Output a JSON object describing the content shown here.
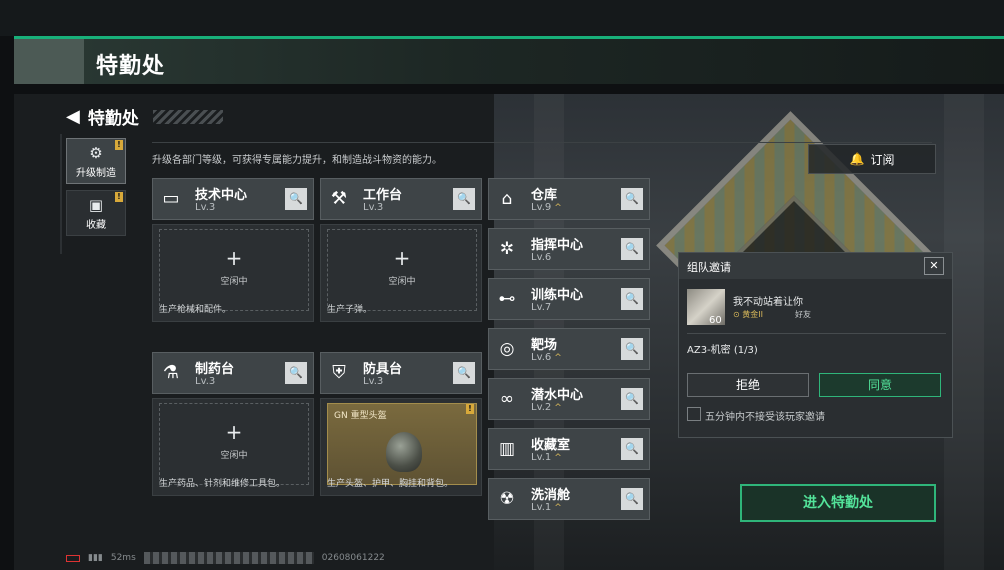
{
  "header": {
    "title": "特勤处"
  },
  "nav": {
    "back_label": "特勤处",
    "back_icon": "back-arrow-icon"
  },
  "description": "升级各部门等级，可获得专属能力提升，和制造战斗物资的能力。",
  "left_tabs": [
    {
      "label": "升级制造",
      "icon": "gear-upgrade-icon",
      "active": true,
      "alert": "!"
    },
    {
      "label": "收藏",
      "icon": "safe-icon",
      "active": false,
      "alert": "!"
    }
  ],
  "cards": [
    {
      "name": "技术中心",
      "level": "Lv.3",
      "icon": "monitor-icon",
      "slot": {
        "plus": "+",
        "status": "空闲中"
      },
      "footer": "生产枪械和配件。"
    },
    {
      "name": "工作台",
      "level": "Lv.3",
      "icon": "tools-icon",
      "slot": {
        "plus": "+",
        "status": "空闲中"
      },
      "footer": "生产子弹。"
    },
    {
      "name": "制药台",
      "level": "Lv.3",
      "icon": "microscope-icon",
      "slot": {
        "plus": "+",
        "status": "空闲中"
      },
      "footer": "生产药品、针剂和维修工具包。"
    },
    {
      "name": "防具台",
      "level": "Lv.3",
      "icon": "armor-icon",
      "slot": {
        "item_name": "GN 重型头盔",
        "alert": "!"
      },
      "footer": "生产头盔、护甲、胸挂和背包。"
    }
  ],
  "departments": [
    {
      "name": "仓库",
      "level": "Lv.9",
      "icon": "warehouse-icon",
      "upgrade": "^"
    },
    {
      "name": "指挥中心",
      "level": "Lv.6",
      "icon": "command-chip-icon",
      "upgrade": ""
    },
    {
      "name": "训练中心",
      "level": "Lv.7",
      "icon": "dumbbell-icon",
      "upgrade": ""
    },
    {
      "name": "靶场",
      "level": "Lv.6",
      "icon": "target-icon",
      "upgrade": "^"
    },
    {
      "name": "潜水中心",
      "level": "Lv.2",
      "icon": "diving-mask-icon",
      "upgrade": "^"
    },
    {
      "name": "收藏室",
      "level": "Lv.1",
      "icon": "vault-icon",
      "upgrade": "^"
    },
    {
      "name": "洗消舱",
      "level": "Lv.1",
      "icon": "hazmat-icon",
      "upgrade": "^"
    }
  ],
  "search_icon_glyph": "🔍",
  "subscribe": {
    "label": "订阅",
    "icon": "bell-icon"
  },
  "invite": {
    "title": "组队邀请",
    "close": "✕",
    "avatar_level": "60",
    "message": "我不动站着让你",
    "rank": "黄金II",
    "relation": "好友",
    "team": "AZ3-机密 (1/3)",
    "reject": "拒绝",
    "accept": "同意",
    "checkbox_label": "五分钟内不接受该玩家邀请"
  },
  "enter_button": "进入特勤处",
  "status": {
    "ping": "52ms",
    "uid": "02608061222"
  },
  "colors": {
    "accent_green": "#2fb57a",
    "alert_gold": "#d8a93a",
    "panel": "#3e4447"
  }
}
